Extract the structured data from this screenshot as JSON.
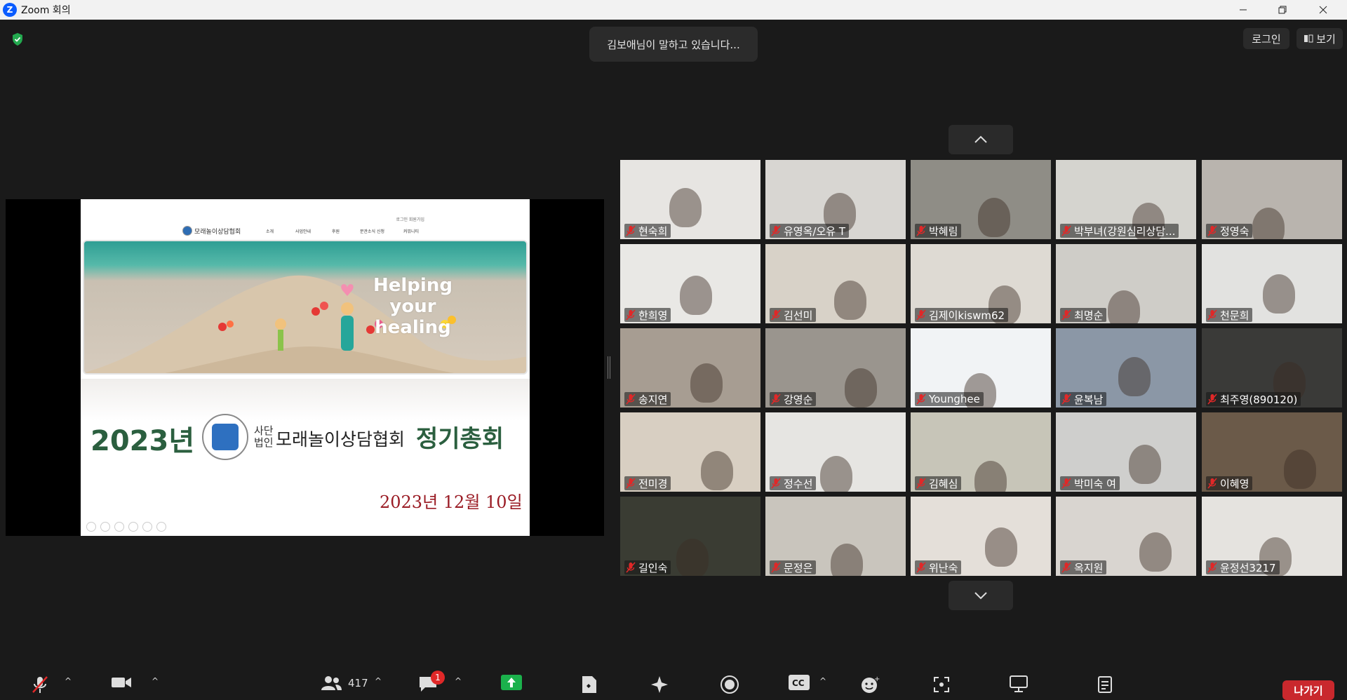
{
  "window": {
    "title": "Zoom 회의",
    "logo_letter": "Z"
  },
  "top": {
    "speaking": "김보애님이 말하고 있습니다...",
    "login": "로그인",
    "view": "보기"
  },
  "slide": {
    "site_util": "로그인  회원가입",
    "site_name": "모래놀이상담협회",
    "site_menu": [
      "소개",
      "사업안내",
      "후원",
      "분관소식 신청",
      "커뮤니티"
    ],
    "hero_text": [
      "Helping",
      "your",
      "healing"
    ],
    "year": "2023년",
    "corp_line1": "사단",
    "corp_line2": "법인",
    "org": "모래놀이상담협회",
    "meeting": "정기총회",
    "date": "2023년  12월  10일"
  },
  "participants": [
    {
      "name": "현숙희",
      "bg": "#e7e5e2"
    },
    {
      "name": "유영옥/오유 T",
      "bg": "#d8d6d2"
    },
    {
      "name": "박혜림",
      "bg": "#8f8d86"
    },
    {
      "name": "박부녀(강원심리상담...",
      "bg": "#d5d4cf"
    },
    {
      "name": "정영숙",
      "bg": "#b9b4ae"
    },
    {
      "name": "한희영",
      "bg": "#e9e8e5"
    },
    {
      "name": "김선미",
      "bg": "#d8d2c8"
    },
    {
      "name": "김제이kiswm62",
      "bg": "#dedad3"
    },
    {
      "name": "최명순",
      "bg": "#cfcdc8"
    },
    {
      "name": "천문희",
      "bg": "#e2e2e0"
    },
    {
      "name": "송지연",
      "bg": "#a79d92"
    },
    {
      "name": "강영순",
      "bg": "#9a958e"
    },
    {
      "name": "Younghee",
      "bg": "#f1f3f5"
    },
    {
      "name": "윤복남",
      "bg": "#8b97a6"
    },
    {
      "name": "최주영(890120)",
      "bg": "#3a3a38"
    },
    {
      "name": "전미경",
      "bg": "#d8cfc2"
    },
    {
      "name": "정수선",
      "bg": "#e6e5e2"
    },
    {
      "name": "김혜심",
      "bg": "#c7c5b8"
    },
    {
      "name": "박미숙 여",
      "bg": "#cfcfcd"
    },
    {
      "name": "이혜영",
      "bg": "#6b5a49"
    },
    {
      "name": "길인숙",
      "bg": "#3a3c33"
    },
    {
      "name": "문정은",
      "bg": "#c9c5bd"
    },
    {
      "name": "위난숙",
      "bg": "#e4dfd9"
    },
    {
      "name": "옥지원",
      "bg": "#d9d5d0"
    },
    {
      "name": "윤정선3217",
      "bg": "#e5e3df"
    }
  ],
  "toolbar": {
    "participants_count": "417",
    "chat_badge": "1",
    "leave": "나가기"
  }
}
